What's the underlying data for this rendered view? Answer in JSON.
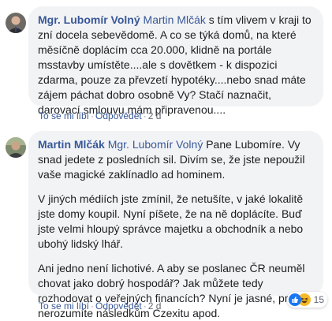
{
  "comments": [
    {
      "author": "Mgr. Lubomír Volný",
      "mention": "Martin Mlčák",
      "paragraphs": [
        "s tím vlivem v kraji to zní docela sebevědomě. A co se týká domů, na které měsíčně doplácím cca 20.000, klidně na portále msstavby umístěte....ale s dovětkem - k dispozici zdarma, pouze za převzetí hypotéky....nebo snad máte zájem páchat dobro osobně Vy? Stačí naznačit, darovací smlouvu mám připravenou...."
      ],
      "actions": {
        "like": "To se mi líbí",
        "reply": "Odpovědět",
        "time": "2 d"
      }
    },
    {
      "author": "Martin Mlčák",
      "mention": "Mgr. Lubomír Volný",
      "paragraphs": [
        "Pane Lubomíre. Vy snad jedete z posledních sil. Divím se, že jste nepoužil vaše magické zaklínadlo ad hominem.",
        "V jiných médiích jste zmínil, že netušíte, v jaké lokalitě jste domy koupil. Nyní píšete, že na ně doplácíte. Buď jste velmi hloupý správce majetku a obchodník a nebo ubohý lidský lhář.",
        "Ani jedno není lichotivé. A aby se poslanec ČR neuměl chovat jako dobrý hospodář? Jak můžete tedy rozhodovat o veřejných financích? Nyní je jasné, proč nerozumíte následkům Czexitu apod."
      ],
      "actions": {
        "like": "To se mi líbí",
        "reply": "Odpovědět",
        "time": "2 d"
      },
      "reactions": {
        "icons": [
          "like-icon",
          "haha-icon"
        ],
        "count": "15"
      }
    }
  ],
  "colors": {
    "link": "#385898",
    "bubble": "#f2f3f5",
    "meta": "#606770"
  }
}
